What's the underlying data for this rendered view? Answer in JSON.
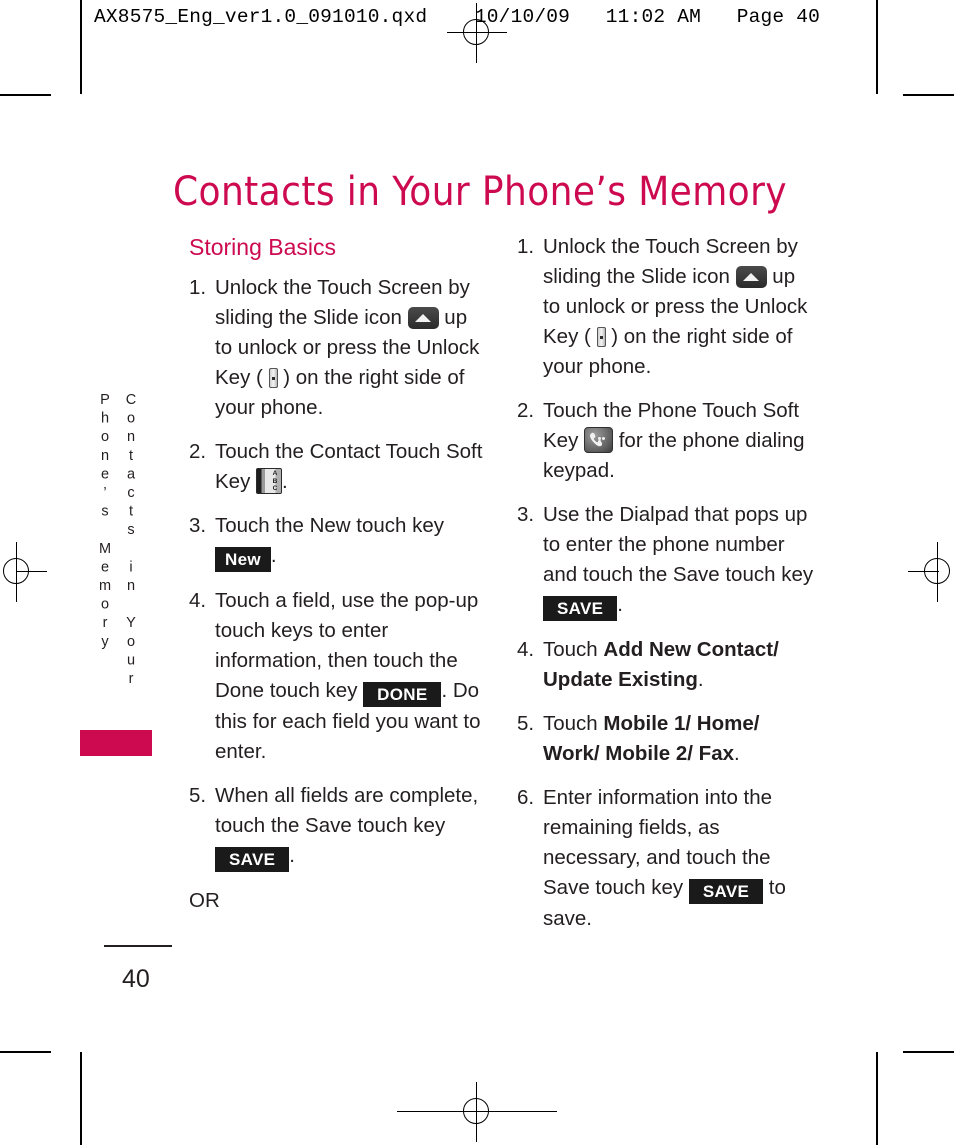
{
  "print": {
    "slug": "AX8575_Eng_ver1.0_091010.qxd    10/10/09   11:02 AM   Page 40"
  },
  "running_head": {
    "vertical_text": "Contacts in Your Phone’s Memory",
    "tab_color": "#cd0a50"
  },
  "page": {
    "title": "Contacts in Your Phone’s Memory",
    "title_color": "#cd0a50",
    "folio": "40"
  },
  "left_column": {
    "heading": "Storing Basics",
    "heading_color": "#cd0a50",
    "steps": [
      {
        "num": "1.",
        "parts": [
          {
            "type": "text",
            "value": "Unlock the Touch Screen by sliding the Slide icon "
          },
          {
            "type": "icon",
            "icon": "slide-icon"
          },
          {
            "type": "text",
            "value": " up to unlock or press the Unlock Key ( "
          },
          {
            "type": "icon",
            "icon": "unlock-key-icon"
          },
          {
            "type": "text",
            "value": " ) on the right side of your phone."
          }
        ]
      },
      {
        "num": "2.",
        "parts": [
          {
            "type": "text",
            "value": "Touch the Contact Touch Soft Key "
          },
          {
            "type": "icon",
            "icon": "contacts-book-icon"
          },
          {
            "type": "text",
            "value": "."
          }
        ]
      },
      {
        "num": "3.",
        "parts": [
          {
            "type": "text",
            "value": "Touch the New touch key "
          },
          {
            "type": "key",
            "label": "New"
          },
          {
            "type": "text",
            "value": "."
          }
        ]
      },
      {
        "num": "4.",
        "parts": [
          {
            "type": "text",
            "value": "Touch a field, use the pop-up touch keys to enter information, then touch the Done touch key "
          },
          {
            "type": "key",
            "label": "DONE"
          },
          {
            "type": "text",
            "value": ". Do this for each field you want to enter."
          }
        ]
      },
      {
        "num": "5.",
        "parts": [
          {
            "type": "text",
            "value": "When all fields are complete, touch the Save touch key "
          },
          {
            "type": "key",
            "label": "SAVE"
          },
          {
            "type": "text",
            "value": "."
          }
        ]
      }
    ],
    "trailing_text": "OR"
  },
  "right_column": {
    "steps": [
      {
        "num": "1.",
        "parts": [
          {
            "type": "text",
            "value": "Unlock the Touch Screen by sliding the Slide icon "
          },
          {
            "type": "icon",
            "icon": "slide-icon"
          },
          {
            "type": "text",
            "value": " up to unlock or press the Unlock Key ( "
          },
          {
            "type": "icon",
            "icon": "unlock-key-icon"
          },
          {
            "type": "text",
            "value": " ) on the right side of your phone."
          }
        ]
      },
      {
        "num": "2.",
        "parts": [
          {
            "type": "text",
            "value": "Touch the Phone Touch Soft Key "
          },
          {
            "type": "icon",
            "icon": "phone-handset-icon"
          },
          {
            "type": "text",
            "value": " for the phone dialing keypad."
          }
        ]
      },
      {
        "num": "3.",
        "parts": [
          {
            "type": "text",
            "value": "Use the Dialpad that pops up to enter the phone number and touch the Save touch key "
          },
          {
            "type": "key",
            "label": "SAVE"
          },
          {
            "type": "text",
            "value": "."
          }
        ]
      },
      {
        "num": "4.",
        "parts": [
          {
            "type": "text",
            "value": "Touch "
          },
          {
            "type": "bold",
            "value": "Add New Contact/ Update Existing"
          },
          {
            "type": "text",
            "value": "."
          }
        ]
      },
      {
        "num": "5.",
        "parts": [
          {
            "type": "text",
            "value": "Touch "
          },
          {
            "type": "bold",
            "value": "Mobile 1/ Home/ Work/ Mobile 2/ Fax"
          },
          {
            "type": "text",
            "value": "."
          }
        ]
      },
      {
        "num": "6.",
        "parts": [
          {
            "type": "text",
            "value": "Enter information into the remaining fields, as necessary, and touch the Save touch key "
          },
          {
            "type": "key",
            "label": "SAVE"
          },
          {
            "type": "text",
            "value": " to save."
          }
        ]
      }
    ]
  }
}
